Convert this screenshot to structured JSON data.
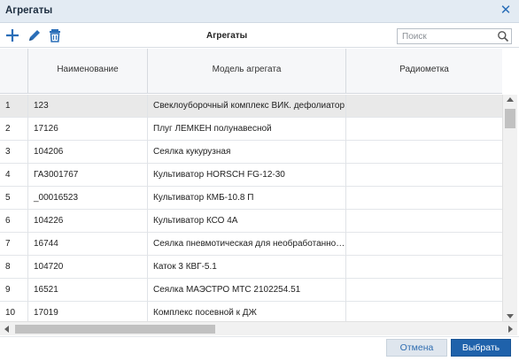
{
  "dialog": {
    "title": "Агрегаты"
  },
  "toolbar": {
    "title": "Агрегаты"
  },
  "search": {
    "placeholder": "Поиск",
    "value": ""
  },
  "columns": [
    "",
    "Наименование",
    "Модель агрегата",
    "Радиометка"
  ],
  "rows": [
    {
      "num": "1",
      "name": "123",
      "model": "Свеклоуборочный комплекс ВИК. дефолиатор",
      "radio": ""
    },
    {
      "num": "2",
      "name": "17126",
      "model": "Плуг ЛЕМКЕН полунавесной",
      "radio": ""
    },
    {
      "num": "3",
      "name": "104206",
      "model": "Сеялка кукурузная",
      "radio": ""
    },
    {
      "num": "4",
      "name": "ГА3001767",
      "model": "Культиватор HORSCH FG-12-30",
      "radio": ""
    },
    {
      "num": "5",
      "name": "_00016523",
      "model": "Культиватор КМБ-10.8 П",
      "radio": ""
    },
    {
      "num": "6",
      "name": "104226",
      "model": "Культиватор КСО 4А",
      "radio": ""
    },
    {
      "num": "7",
      "name": "16744",
      "model": "Сеялка пневмотическая для необработанной почвы",
      "radio": ""
    },
    {
      "num": "8",
      "name": "104720",
      "model": "Каток 3 КВГ-5.1",
      "radio": ""
    },
    {
      "num": "9",
      "name": "16521",
      "model": "Сеялка МАЭСТРО МТС 2102254.51",
      "radio": ""
    },
    {
      "num": "10",
      "name": "17019",
      "model": "Комплекс посевной к ДЖ",
      "radio": ""
    }
  ],
  "selected_row": 1,
  "footer": {
    "cancel_label": "Отмена",
    "ok_label": "Выбрать"
  },
  "icons": {
    "add": "plus-icon",
    "edit": "pencil-icon",
    "delete": "trash-icon",
    "search": "search-icon",
    "close": "close-icon"
  },
  "colors": {
    "accent": "#1f62ab",
    "titlebar": "#e3ebf3",
    "selected_row": "#e9e9e9",
    "icon": "#2a6eb8"
  }
}
